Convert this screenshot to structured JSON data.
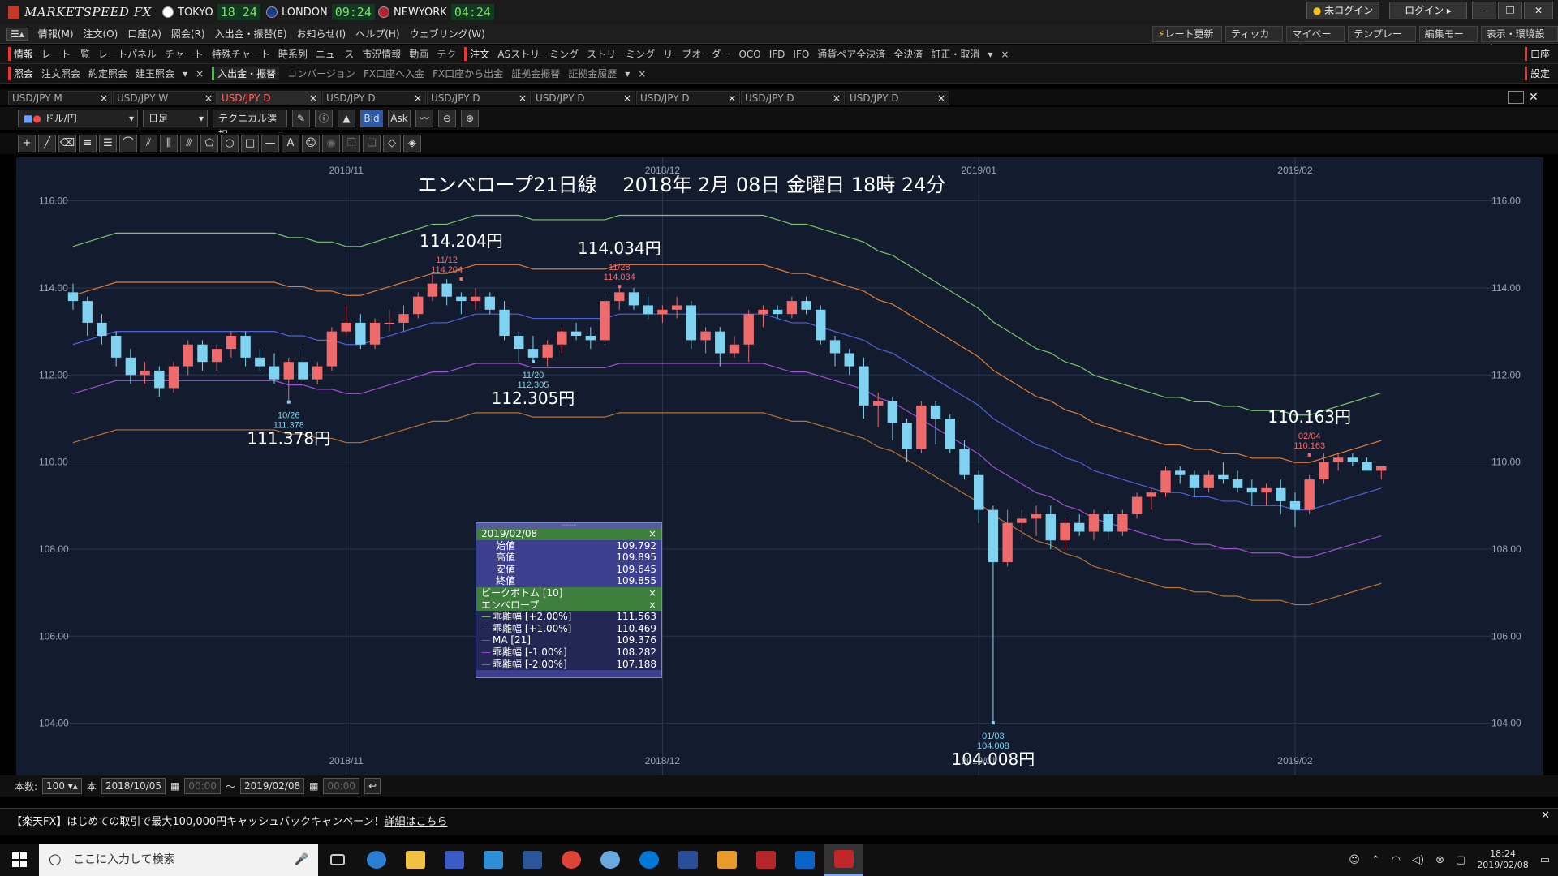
{
  "app": {
    "title": "MARKETSPEED FX"
  },
  "clocks": [
    {
      "city": "TOKYO",
      "time": "18 24",
      "flag": "#cc0000"
    },
    {
      "city": "LONDON",
      "time": "09:24",
      "flag": "#003399"
    },
    {
      "city": "NEWYORK",
      "time": "04:24",
      "flag": "#b22234"
    }
  ],
  "titlebar_buttons": {
    "status": "未ログイン",
    "login": "ログイン"
  },
  "menu": [
    "情報(M)",
    "注文(O)",
    "口座(A)",
    "照会(R)",
    "入出金・振替(E)",
    "お知らせ(I)",
    "ヘルプ(H)",
    "ウェブリング(W)"
  ],
  "right_menu": [
    "レート更新",
    "ティッカー",
    "マイページ",
    "テンプレート",
    "編集モード",
    "表示・環境設定"
  ],
  "toolbar1": {
    "info": "情報",
    "items": [
      "レート一覧",
      "レートパネル",
      "チャート",
      "特殊チャート",
      "時系列",
      "ニュース",
      "市況情報",
      "動画",
      "テク"
    ],
    "order": "注文",
    "order_items": [
      "ASストリーミング",
      "ストリーミング",
      "リーブオーダー",
      "OCO",
      "IFD",
      "IFO",
      "通貨ペア全決済",
      "全決済",
      "訂正・取消"
    ],
    "right": "口座"
  },
  "toolbar2": {
    "inquiry": "照会",
    "items": [
      "注文照会",
      "約定照会",
      "建玉照会"
    ],
    "transfer": "入出金・振替",
    "items2": [
      "コンバージョン",
      "FX口座へ入金",
      "FX口座から出金",
      "証拠金振替",
      "証拠金履歴"
    ],
    "right": "設定"
  },
  "tabs": [
    "USD/JPY M",
    "USD/JPY W",
    "USD/JPY D",
    "USD/JPY D",
    "USD/JPY D",
    "USD/JPY D",
    "USD/JPY D",
    "USD/JPY D",
    "USD/JPY D"
  ],
  "active_tab": 2,
  "charttool": {
    "pair": "ドル/円",
    "period": "日足",
    "tech": "テクニカル選択",
    "bid": "Bid",
    "ask": "Ask"
  },
  "footer": {
    "count_label": "本数:",
    "count": "100",
    "unit": "本",
    "from": "2018/10/05",
    "sep": "〜",
    "to": "2019/02/08",
    "time": "00:00"
  },
  "news": {
    "text": "【楽天FX】はじめての取引で最大100,000円キャッシュバックキャンペーン！",
    "link": "詳細はこちら"
  },
  "taskbar": {
    "search": "ここに入力して検索",
    "time": "18:24",
    "date": "2019/02/08"
  },
  "colors": {
    "bg": "#131c2e",
    "up": "#ef6a6a",
    "down": "#7fd3f0",
    "ma": "#4f63d9",
    "plus2": "#7ec36a",
    "plus1": "#e07b35",
    "minus1": "#a14fd6",
    "minus2": "#b8722f"
  },
  "chart_data": {
    "type": "candlestick",
    "title": "エンベロープ21日線　 2018年 2月 08日 金曜日 18時 24分",
    "ylim": [
      102.8,
      117.0
    ],
    "yticks": [
      "116.00",
      "114.00",
      "112.00",
      "110.00",
      "108.00",
      "106.00",
      "104.00"
    ],
    "xticks": [
      {
        "label": "2018/11",
        "i": 19
      },
      {
        "label": "2018/12",
        "i": 41
      },
      {
        "label": "2019/01",
        "i": 63
      },
      {
        "label": "2019/02",
        "i": 85
      }
    ],
    "candles": [
      [
        113.9,
        114.1,
        113.5,
        113.7
      ],
      [
        113.7,
        113.8,
        112.9,
        113.2
      ],
      [
        113.2,
        113.4,
        112.7,
        112.9
      ],
      [
        112.9,
        113.0,
        112.2,
        112.4
      ],
      [
        112.4,
        112.6,
        111.8,
        112.0
      ],
      [
        112.0,
        112.3,
        111.8,
        112.1
      ],
      [
        112.1,
        112.2,
        111.5,
        111.7
      ],
      [
        111.7,
        112.3,
        111.6,
        112.2
      ],
      [
        112.2,
        112.8,
        112.0,
        112.7
      ],
      [
        112.7,
        112.8,
        112.1,
        112.3
      ],
      [
        112.3,
        112.7,
        112.1,
        112.6
      ],
      [
        112.6,
        113.0,
        112.4,
        112.9
      ],
      [
        112.9,
        113.0,
        112.2,
        112.4
      ],
      [
        112.4,
        112.6,
        112.1,
        112.2
      ],
      [
        112.2,
        112.5,
        111.8,
        111.9
      ],
      [
        111.9,
        112.4,
        111.4,
        112.3
      ],
      [
        112.3,
        112.6,
        111.7,
        111.9
      ],
      [
        111.9,
        112.3,
        111.8,
        112.2
      ],
      [
        112.2,
        113.1,
        112.1,
        113.0
      ],
      [
        113.0,
        113.6,
        112.9,
        113.2
      ],
      [
        113.2,
        113.4,
        112.6,
        112.7
      ],
      [
        112.7,
        113.3,
        112.6,
        113.2
      ],
      [
        113.2,
        113.5,
        113.0,
        113.2
      ],
      [
        113.2,
        113.6,
        113.0,
        113.4
      ],
      [
        113.4,
        113.9,
        113.3,
        113.8
      ],
      [
        113.8,
        114.3,
        113.7,
        114.1
      ],
      [
        114.1,
        114.2,
        113.6,
        113.8
      ],
      [
        113.8,
        113.9,
        113.4,
        113.7
      ],
      [
        113.7,
        114.0,
        113.5,
        113.8
      ],
      [
        113.8,
        113.9,
        113.4,
        113.5
      ],
      [
        113.5,
        113.7,
        112.8,
        112.9
      ],
      [
        112.9,
        113.0,
        112.3,
        112.6
      ],
      [
        112.6,
        112.9,
        112.3,
        112.4
      ],
      [
        112.4,
        112.8,
        112.2,
        112.7
      ],
      [
        112.7,
        113.1,
        112.5,
        113.0
      ],
      [
        113.0,
        113.2,
        112.8,
        112.9
      ],
      [
        112.9,
        113.1,
        112.6,
        112.8
      ],
      [
        112.8,
        113.8,
        112.7,
        113.7
      ],
      [
        113.7,
        114.0,
        113.5,
        113.9
      ],
      [
        113.9,
        114.0,
        113.5,
        113.6
      ],
      [
        113.6,
        113.8,
        113.3,
        113.4
      ],
      [
        113.4,
        113.6,
        113.2,
        113.5
      ],
      [
        113.5,
        113.8,
        113.3,
        113.6
      ],
      [
        113.6,
        113.7,
        112.6,
        112.8
      ],
      [
        112.8,
        113.1,
        112.5,
        113.0
      ],
      [
        113.0,
        113.1,
        112.2,
        112.5
      ],
      [
        112.5,
        112.9,
        112.4,
        112.7
      ],
      [
        112.7,
        113.5,
        112.3,
        113.4
      ],
      [
        113.4,
        113.6,
        113.1,
        113.5
      ],
      [
        113.5,
        113.6,
        113.3,
        113.4
      ],
      [
        113.4,
        113.8,
        113.3,
        113.7
      ],
      [
        113.7,
        113.8,
        113.4,
        113.5
      ],
      [
        113.5,
        113.6,
        112.7,
        112.8
      ],
      [
        112.8,
        112.9,
        112.2,
        112.5
      ],
      [
        112.5,
        112.6,
        112.0,
        112.2
      ],
      [
        112.2,
        112.4,
        111.0,
        111.3
      ],
      [
        111.3,
        111.6,
        110.8,
        111.4
      ],
      [
        111.4,
        111.5,
        110.5,
        110.9
      ],
      [
        110.9,
        111.0,
        110.0,
        110.3
      ],
      [
        110.3,
        111.4,
        110.2,
        111.3
      ],
      [
        111.3,
        111.4,
        110.4,
        111.0
      ],
      [
        111.0,
        111.1,
        110.2,
        110.3
      ],
      [
        110.3,
        110.5,
        109.6,
        109.7
      ],
      [
        109.7,
        109.8,
        108.6,
        108.9
      ],
      [
        108.9,
        109.0,
        104.0,
        107.7
      ],
      [
        107.7,
        108.9,
        107.6,
        108.6
      ],
      [
        108.6,
        108.9,
        108.2,
        108.7
      ],
      [
        108.7,
        109.0,
        108.3,
        108.8
      ],
      [
        108.8,
        109.0,
        108.0,
        108.2
      ],
      [
        108.2,
        108.7,
        108.0,
        108.6
      ],
      [
        108.6,
        108.8,
        108.3,
        108.4
      ],
      [
        108.4,
        108.9,
        108.2,
        108.8
      ],
      [
        108.8,
        108.9,
        108.2,
        108.4
      ],
      [
        108.4,
        108.9,
        108.3,
        108.8
      ],
      [
        108.8,
        109.3,
        108.7,
        109.2
      ],
      [
        109.2,
        109.4,
        108.9,
        109.3
      ],
      [
        109.3,
        109.9,
        109.2,
        109.8
      ],
      [
        109.8,
        109.9,
        109.5,
        109.7
      ],
      [
        109.7,
        109.8,
        109.2,
        109.4
      ],
      [
        109.4,
        109.8,
        109.3,
        109.7
      ],
      [
        109.7,
        110.0,
        109.5,
        109.6
      ],
      [
        109.6,
        109.8,
        109.3,
        109.4
      ],
      [
        109.4,
        109.6,
        109.0,
        109.3
      ],
      [
        109.3,
        109.5,
        109.0,
        109.4
      ],
      [
        109.4,
        109.6,
        108.8,
        109.1
      ],
      [
        109.1,
        109.3,
        108.5,
        108.9
      ],
      [
        108.9,
        109.7,
        108.8,
        109.6
      ],
      [
        109.6,
        110.2,
        109.5,
        110.0
      ],
      [
        110.0,
        110.2,
        109.8,
        110.1
      ],
      [
        110.1,
        110.2,
        109.9,
        110.0
      ],
      [
        110.0,
        110.1,
        109.8,
        109.8
      ],
      [
        109.8,
        109.9,
        109.6,
        109.9
      ]
    ],
    "ma21": [
      112.7,
      112.8,
      112.9,
      113.0,
      113.0,
      113.0,
      113.0,
      113.0,
      113.0,
      113.0,
      113.0,
      113.0,
      113.0,
      113.0,
      113.0,
      112.9,
      112.9,
      112.8,
      112.8,
      112.7,
      112.7,
      112.8,
      112.9,
      113.0,
      113.1,
      113.2,
      113.2,
      113.3,
      113.4,
      113.4,
      113.4,
      113.4,
      113.3,
      113.3,
      113.3,
      113.3,
      113.3,
      113.3,
      113.4,
      113.4,
      113.4,
      113.4,
      113.4,
      113.4,
      113.4,
      113.4,
      113.4,
      113.4,
      113.4,
      113.3,
      113.2,
      113.2,
      113.1,
      113.0,
      112.9,
      112.8,
      112.6,
      112.5,
      112.3,
      112.1,
      111.9,
      111.7,
      111.5,
      111.3,
      111.0,
      110.8,
      110.6,
      110.4,
      110.3,
      110.1,
      110.0,
      109.8,
      109.7,
      109.6,
      109.5,
      109.4,
      109.3,
      109.3,
      109.2,
      109.2,
      109.1,
      109.1,
      109.0,
      109.0,
      109.0,
      108.9,
      108.9,
      109.0,
      109.1,
      109.2,
      109.3,
      109.4
    ],
    "labels": [
      {
        "text": "114.204円",
        "i": 27,
        "v": 114.204,
        "pos": "above",
        "size": "big"
      },
      {
        "text": "11/12",
        "i": 26,
        "v": 114.204,
        "pos": "small-above",
        "color": "#ef6a6a"
      },
      {
        "text": "114.034円",
        "i": 38,
        "v": 114.034,
        "pos": "above",
        "size": "big"
      },
      {
        "text": "11/28",
        "i": 38,
        "v": 114.034,
        "pos": "small-above",
        "color": "#ef6a6a"
      },
      {
        "text": "111.378円",
        "i": 15,
        "v": 111.378,
        "pos": "below",
        "size": "big"
      },
      {
        "text": "10/26",
        "i": 15,
        "v": 111.378,
        "pos": "small-below",
        "color": "#7fd3f0"
      },
      {
        "text": "112.305円",
        "i": 32,
        "v": 112.305,
        "pos": "below",
        "size": "big"
      },
      {
        "text": "11/20",
        "i": 32,
        "v": 112.305,
        "pos": "small-below",
        "color": "#7fd3f0"
      },
      {
        "text": "104.008円",
        "i": 64,
        "v": 104.008,
        "pos": "below",
        "size": "big"
      },
      {
        "text": "01/03",
        "i": 64,
        "v": 104.008,
        "pos": "small-below",
        "color": "#7fd3f0"
      },
      {
        "text": "110.163円",
        "i": 86,
        "v": 110.163,
        "pos": "above",
        "size": "big"
      },
      {
        "text": "02/04",
        "i": 86,
        "v": 110.163,
        "pos": "small-above",
        "color": "#ef6a6a"
      }
    ],
    "small_values": {
      "11/12": "114.204",
      "11/28": "114.034",
      "10/26": "111.378",
      "11/20": "112.305",
      "01/03": "104.008",
      "02/04": "110.163"
    }
  },
  "infobox": {
    "date": "2019/02/08",
    "ohlc": [
      [
        "始値",
        "109.792"
      ],
      [
        "高値",
        "109.895"
      ],
      [
        "安値",
        "109.645"
      ],
      [
        "終値",
        "109.855"
      ]
    ],
    "peak": "ピークボトム [10]",
    "env": "エンベロープ",
    "rows": [
      [
        "乖離幅 [+2.00%]",
        "111.563",
        "#7ec36a"
      ],
      [
        "乖離幅 [+1.00%]",
        "110.469",
        "#e07b35"
      ],
      [
        "MA [21]",
        "109.376",
        "#4f63d9"
      ],
      [
        "乖離幅 [-1.00%]",
        "108.282",
        "#a14fd6"
      ],
      [
        "乖離幅 [-2.00%]",
        "107.188",
        "#b8722f"
      ]
    ]
  }
}
